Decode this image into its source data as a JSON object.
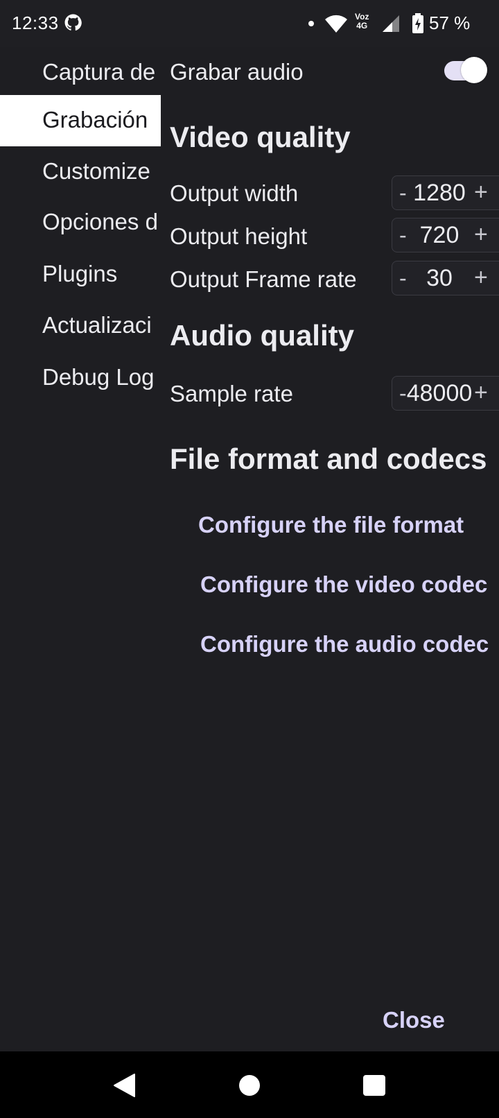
{
  "status_bar": {
    "time": "12:33",
    "network_label_top": "Voz",
    "network_label_bottom": "4G",
    "battery": "57 %"
  },
  "sidebar": {
    "items": [
      {
        "label": "Captura de"
      },
      {
        "label": "Grabación"
      },
      {
        "label": "Customize"
      },
      {
        "label": "Opciones d"
      },
      {
        "label": "Plugins"
      },
      {
        "label": "Actualizaci"
      },
      {
        "label": "Debug Log"
      }
    ],
    "active_index": 1
  },
  "main": {
    "record_audio": {
      "label": "Grabar audio",
      "enabled": true
    },
    "video_section": "Video quality",
    "output_width": {
      "label": "Output width",
      "value": "1280",
      "minus": "-",
      "plus": "+"
    },
    "output_height": {
      "label": "Output height",
      "value": "720",
      "minus": "-",
      "plus": "+"
    },
    "output_frame_rate": {
      "label": "Output Frame rate",
      "value": "30",
      "minus": "-",
      "plus": "+"
    },
    "audio_section": "Audio quality",
    "sample_rate": {
      "label": "Sample rate",
      "value": "48000",
      "minus": "-",
      "plus": "+"
    },
    "file_section": "File format and codecs",
    "links": {
      "file_format": "Configure the file format",
      "video_codec": "Configure the video codec",
      "audio_codec": "Configure the audio codec"
    }
  },
  "actions": {
    "close_label": "Close"
  },
  "colors": {
    "accent": "#d7d2f8",
    "background": "#1e1e22",
    "active_item": "#ffffff"
  },
  "icons": [
    "github-icon",
    "wifi-icon",
    "signal-icon",
    "battery-charging-icon",
    "back-icon",
    "home-icon",
    "recents-icon"
  ]
}
